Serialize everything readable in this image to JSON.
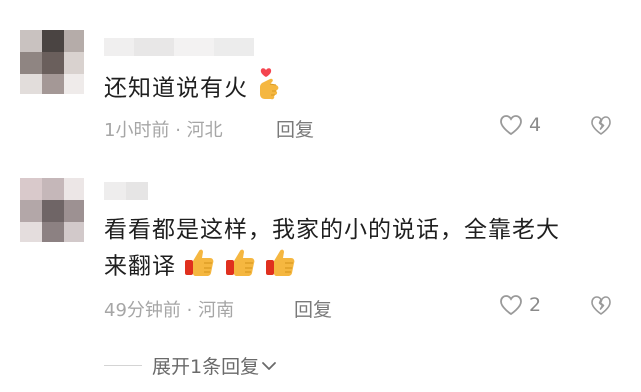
{
  "comments": [
    {
      "text": "还知道说有火",
      "emoji": "finger-heart-icon",
      "time": "1小时前",
      "location": "河北",
      "reply_label": "回复",
      "like_count": "4"
    },
    {
      "text_line1": "看看都是这样，我家的小的说话，全靠老大",
      "text_line2": "来翻译",
      "emoji": "thumbs-up-icon",
      "time": "49分钟前",
      "location": "河南",
      "reply_label": "回复",
      "like_count": "2"
    }
  ],
  "expand_label": "展开1条回复",
  "colors": {
    "like": "#9a9a9a",
    "heart": "#f4444f",
    "emoji_hand": "#f5b740",
    "emoji_shadow": "#e0301e"
  }
}
